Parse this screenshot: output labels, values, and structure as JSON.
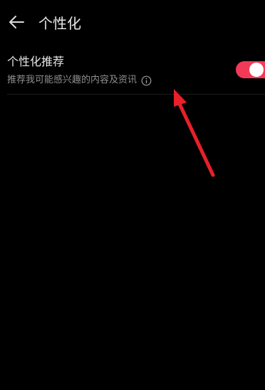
{
  "header": {
    "title": "个性化"
  },
  "setting": {
    "title": "个性化推荐",
    "description": "推荐我可能感兴趣的内容及资讯",
    "toggle_on": true
  },
  "colors": {
    "background": "#000000",
    "accent": "#f23a58",
    "annotation_arrow": "#e8202a"
  }
}
